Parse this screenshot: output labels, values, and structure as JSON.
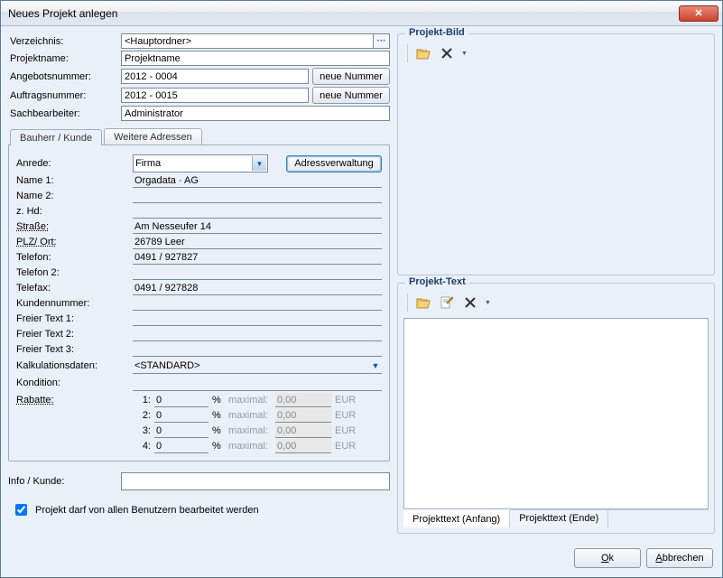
{
  "window": {
    "title": "Neues Projekt anlegen"
  },
  "top": {
    "labels": {
      "verzeichnis": "Verzeichnis:",
      "projektname": "Projektname:",
      "angebotsnr": "Angebotsnummer:",
      "auftragsnr": "Auftragsnummer:",
      "sachbearbeiter": "Sachbearbeiter:"
    },
    "verzeichnis": "<Hauptordner>",
    "projektname": "Projektname",
    "angebotsnr": "2012 - 0004",
    "auftragsnr": "2012 - 0015",
    "sachbearbeiter": "Administrator",
    "neue_nummer": "neue Nummer"
  },
  "tabs": {
    "bauherr": "Bauherr / Kunde",
    "weitere": "Weitere Adressen"
  },
  "form": {
    "labels": {
      "anrede": "Anrede:",
      "name1": "Name 1:",
      "name2": "Name 2:",
      "zhd": "z. Hd:",
      "strasse": "Straße:",
      "plzort": "PLZ/ Ort:",
      "telefon": "Telefon:",
      "telefon2": "Telefon 2:",
      "telefax": "Telefax:",
      "kundennr": "Kundennummer:",
      "ftext1": "Freier Text 1:",
      "ftext2": "Freier Text 2:",
      "ftext3": "Freier Text 3:",
      "kalkdaten": "Kalkulationsdaten:",
      "kondition": "Kondition:",
      "rabatte": "Rabatte:",
      "maximal": "maximal:",
      "currency": "EUR"
    },
    "anrede": "Firma",
    "adressverwaltung": "Adressverwaltung",
    "name1": "Orgadata · AG",
    "name2": "",
    "zhd": "",
    "strasse": "Am Nesseufer 14",
    "plzort": "26789 Leer",
    "telefon": "0491 / 927827",
    "telefon2": "",
    "telefax": "0491 / 927828",
    "kundennr": "",
    "ftext1": "",
    "ftext2": "",
    "ftext3": "",
    "kalkdaten": "<STANDARD>",
    "kondition": "",
    "rabatte": [
      {
        "n": "1:",
        "val": "0",
        "max": "0,00"
      },
      {
        "n": "2:",
        "val": "0",
        "max": "0,00"
      },
      {
        "n": "3:",
        "val": "0",
        "max": "0,00"
      },
      {
        "n": "4:",
        "val": "0",
        "max": "0,00"
      }
    ],
    "percent": "%"
  },
  "info": {
    "label": "Info / Kunde:",
    "value": ""
  },
  "check": {
    "label": "Projekt darf von allen Benutzern bearbeitet werden",
    "checked": true
  },
  "bild": {
    "legend": "Projekt-Bild"
  },
  "text": {
    "legend": "Projekt-Text",
    "tabs": {
      "anfang": "Projekttext (Anfang)",
      "ende": "Projekttext (Ende)"
    }
  },
  "buttons": {
    "ok_u": "O",
    "ok_rest": "k",
    "abbrechen_u": "A",
    "abbrechen_rest": "bbrechen"
  },
  "icons": {
    "close": "✕",
    "ellipsis": "···",
    "down": "▼"
  }
}
